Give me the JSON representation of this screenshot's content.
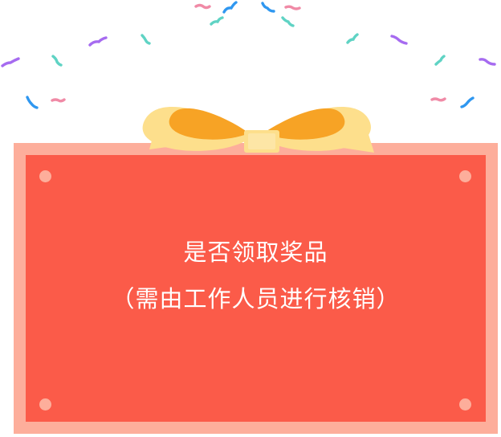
{
  "dialog": {
    "line1": "是否领取奖品",
    "line2": "（需由工作人员进行核销）"
  },
  "colors": {
    "card_border": "#fdae9b",
    "card_fill": "#fb5b49",
    "bow_outer": "#fddf8c",
    "bow_inner": "#f7a325",
    "confetti_purple": "#a66bf0",
    "confetti_teal": "#5fd3c4",
    "confetti_blue": "#2f97f0",
    "confetti_pink": "#f08aa6"
  },
  "icons": [
    "confetti-icon",
    "gift-bow-icon"
  ]
}
